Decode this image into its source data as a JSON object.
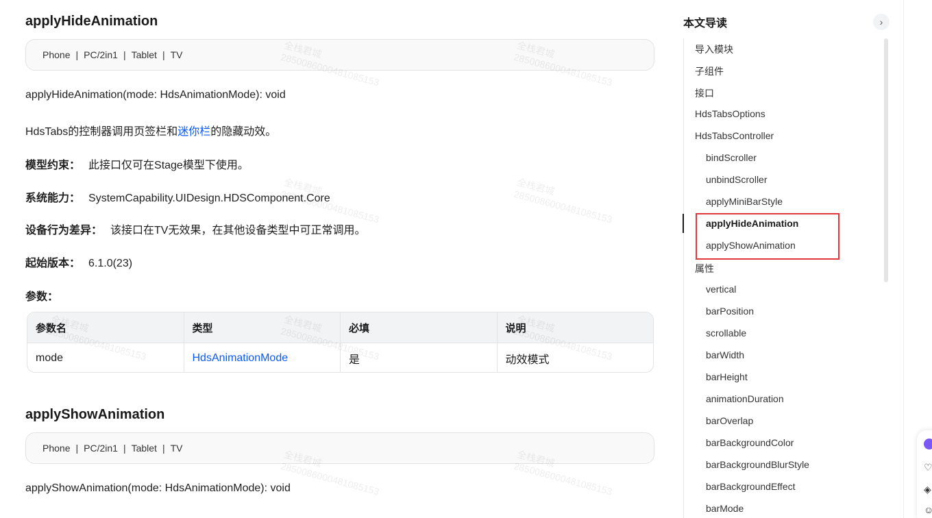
{
  "sections": [
    {
      "title": "applyHideAnimation",
      "devices": [
        "Phone",
        "PC/2in1",
        "Tablet",
        "TV"
      ],
      "signature": "applyHideAnimation(mode: HdsAnimationMode): void",
      "desc_prefix": "HdsTabs的控制器调用页签栏和",
      "desc_link": "迷你栏",
      "desc_suffix": "的隐藏动效。",
      "model_label": "模型约束：",
      "model_value": "此接口仅可在Stage模型下使用。",
      "syscap_label": "系统能力：",
      "syscap_value": "SystemCapability.UIDesign.HDSComponent.Core",
      "diff_label": "设备行为差异：",
      "diff_value": "该接口在TV无效果，在其他设备类型中可正常调用。",
      "since_label": "起始版本：",
      "since_value": "6.1.0(23)",
      "params_label": "参数：",
      "table": {
        "headers": [
          "参数名",
          "类型",
          "必填",
          "说明"
        ],
        "rows": [
          [
            "mode",
            "HdsAnimationMode",
            "是",
            "动效模式"
          ]
        ]
      }
    },
    {
      "title": "applyShowAnimation",
      "devices": [
        "Phone",
        "PC/2in1",
        "Tablet",
        "TV"
      ],
      "signature": "applyShowAnimation(mode: HdsAnimationMode): void"
    }
  ],
  "device_separator": "|",
  "watermark": {
    "line1": "全栈君城",
    "line2": "28500860004810851­53"
  },
  "toc": {
    "title": "本文导读",
    "toggle_icon": "›",
    "items": [
      {
        "label": "导入模块",
        "level": 1
      },
      {
        "label": "子组件",
        "level": 1
      },
      {
        "label": "接口",
        "level": 1
      },
      {
        "label": "HdsTabsOptions",
        "level": 1
      },
      {
        "label": "HdsTabsController",
        "level": 1
      },
      {
        "label": "bindScroller",
        "level": 2
      },
      {
        "label": "unbindScroller",
        "level": 2
      },
      {
        "label": "applyMiniBarStyle",
        "level": 2
      },
      {
        "label": "applyHideAnimation",
        "level": 2,
        "active": true
      },
      {
        "label": "applyShowAnimation",
        "level": 2
      },
      {
        "label": "属性",
        "level": 1
      },
      {
        "label": "vertical",
        "level": 2
      },
      {
        "label": "barPosition",
        "level": 2
      },
      {
        "label": "scrollable",
        "level": 2
      },
      {
        "label": "barWidth",
        "level": 2
      },
      {
        "label": "barHeight",
        "level": 2
      },
      {
        "label": "animationDuration",
        "level": 2
      },
      {
        "label": "barOverlap",
        "level": 2
      },
      {
        "label": "barBackgroundColor",
        "level": 2
      },
      {
        "label": "barBackgroundBlurStyle",
        "level": 2
      },
      {
        "label": "barBackgroundEffect",
        "level": 2
      },
      {
        "label": "barMode",
        "level": 2
      }
    ]
  },
  "colors": {
    "link": "#0a59f7",
    "highlight": "#e0363d"
  }
}
